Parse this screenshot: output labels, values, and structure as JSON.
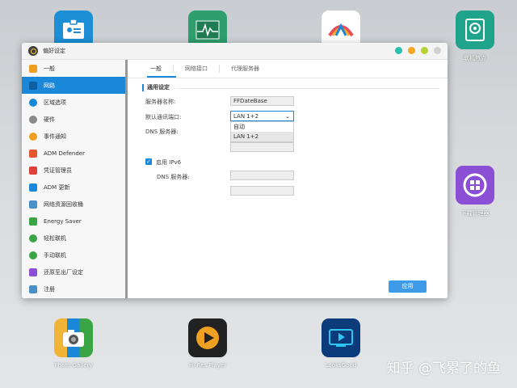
{
  "desktop": {
    "icons_top": [
      {
        "label": "",
        "color": "#1c8ed6"
      },
      {
        "label": "",
        "color": "#2e9e6e"
      },
      {
        "label": "",
        "color": "#ffffff"
      },
      {
        "label": "联机热点",
        "color": "#1fa38a"
      }
    ],
    "icons_right": {
      "label": "下载管理器",
      "color": "#8b4fd6"
    },
    "icons_bottom": [
      {
        "label": "Photo Gallery",
        "color": "#f2b437"
      },
      {
        "label": "Hi-Res Player",
        "color": "#222222"
      },
      {
        "label": "LooksGood",
        "color": "#0b3b7a"
      }
    ],
    "watermark": "知乎 @飞累了的鱼"
  },
  "window": {
    "title": "偏好设定",
    "dots": [
      "#2bbfae",
      "#f5a623",
      "#b8d233",
      "#d0d0d0"
    ],
    "sidebar": [
      {
        "label": "一般",
        "icon": "general-icon",
        "color": "#f0a020",
        "active": false
      },
      {
        "label": "网路",
        "icon": "network-icon",
        "color": "#1a87d9",
        "active": true
      },
      {
        "label": "区域选项",
        "icon": "globe-icon",
        "color": "#1a87d9",
        "active": false
      },
      {
        "label": "硬件",
        "icon": "hardware-icon",
        "color": "#8a8a8a",
        "active": false
      },
      {
        "label": "事件通知",
        "icon": "notification-icon",
        "color": "#f0a020",
        "active": false
      },
      {
        "label": "ADM Defender",
        "icon": "defender-icon",
        "color": "#e4572e",
        "active": false
      },
      {
        "label": "凭证管理员",
        "icon": "certificate-icon",
        "color": "#e0403a",
        "active": false
      },
      {
        "label": "ADM 更新",
        "icon": "update-icon",
        "color": "#1a87d9",
        "active": false
      },
      {
        "label": "网络资源回收桶",
        "icon": "recycle-icon",
        "color": "#4a90c8",
        "active": false
      },
      {
        "label": "Energy Saver",
        "icon": "energy-icon",
        "color": "#3aa544",
        "active": false
      },
      {
        "label": "轻松联机",
        "icon": "ezconnect-icon",
        "color": "#3aa544",
        "active": false
      },
      {
        "label": "手动联机",
        "icon": "manual-connect-icon",
        "color": "#3aa544",
        "active": false
      },
      {
        "label": "还原至出厂设定",
        "icon": "reset-icon",
        "color": "#8b4fd6",
        "active": false
      },
      {
        "label": "注册",
        "icon": "register-icon",
        "color": "#4a90c8",
        "active": false
      }
    ],
    "tabs": [
      "一般",
      "网络接口",
      "代理服务器"
    ],
    "active_tab": 0,
    "section_title": "通用设定",
    "server_name_label": "服务器名称:",
    "server_name_value": "FFDateBase",
    "default_gateway_label": "默认通讯端口:",
    "default_gateway_value": "LAN 1+2",
    "dropdown_options": [
      "自动",
      "LAN 1+2"
    ],
    "dns_label": "DNS 服务器:",
    "ipv6_label": "启用 IPv6",
    "ipv6_dns_label": "DNS 服务器:",
    "apply_label": "应用"
  }
}
